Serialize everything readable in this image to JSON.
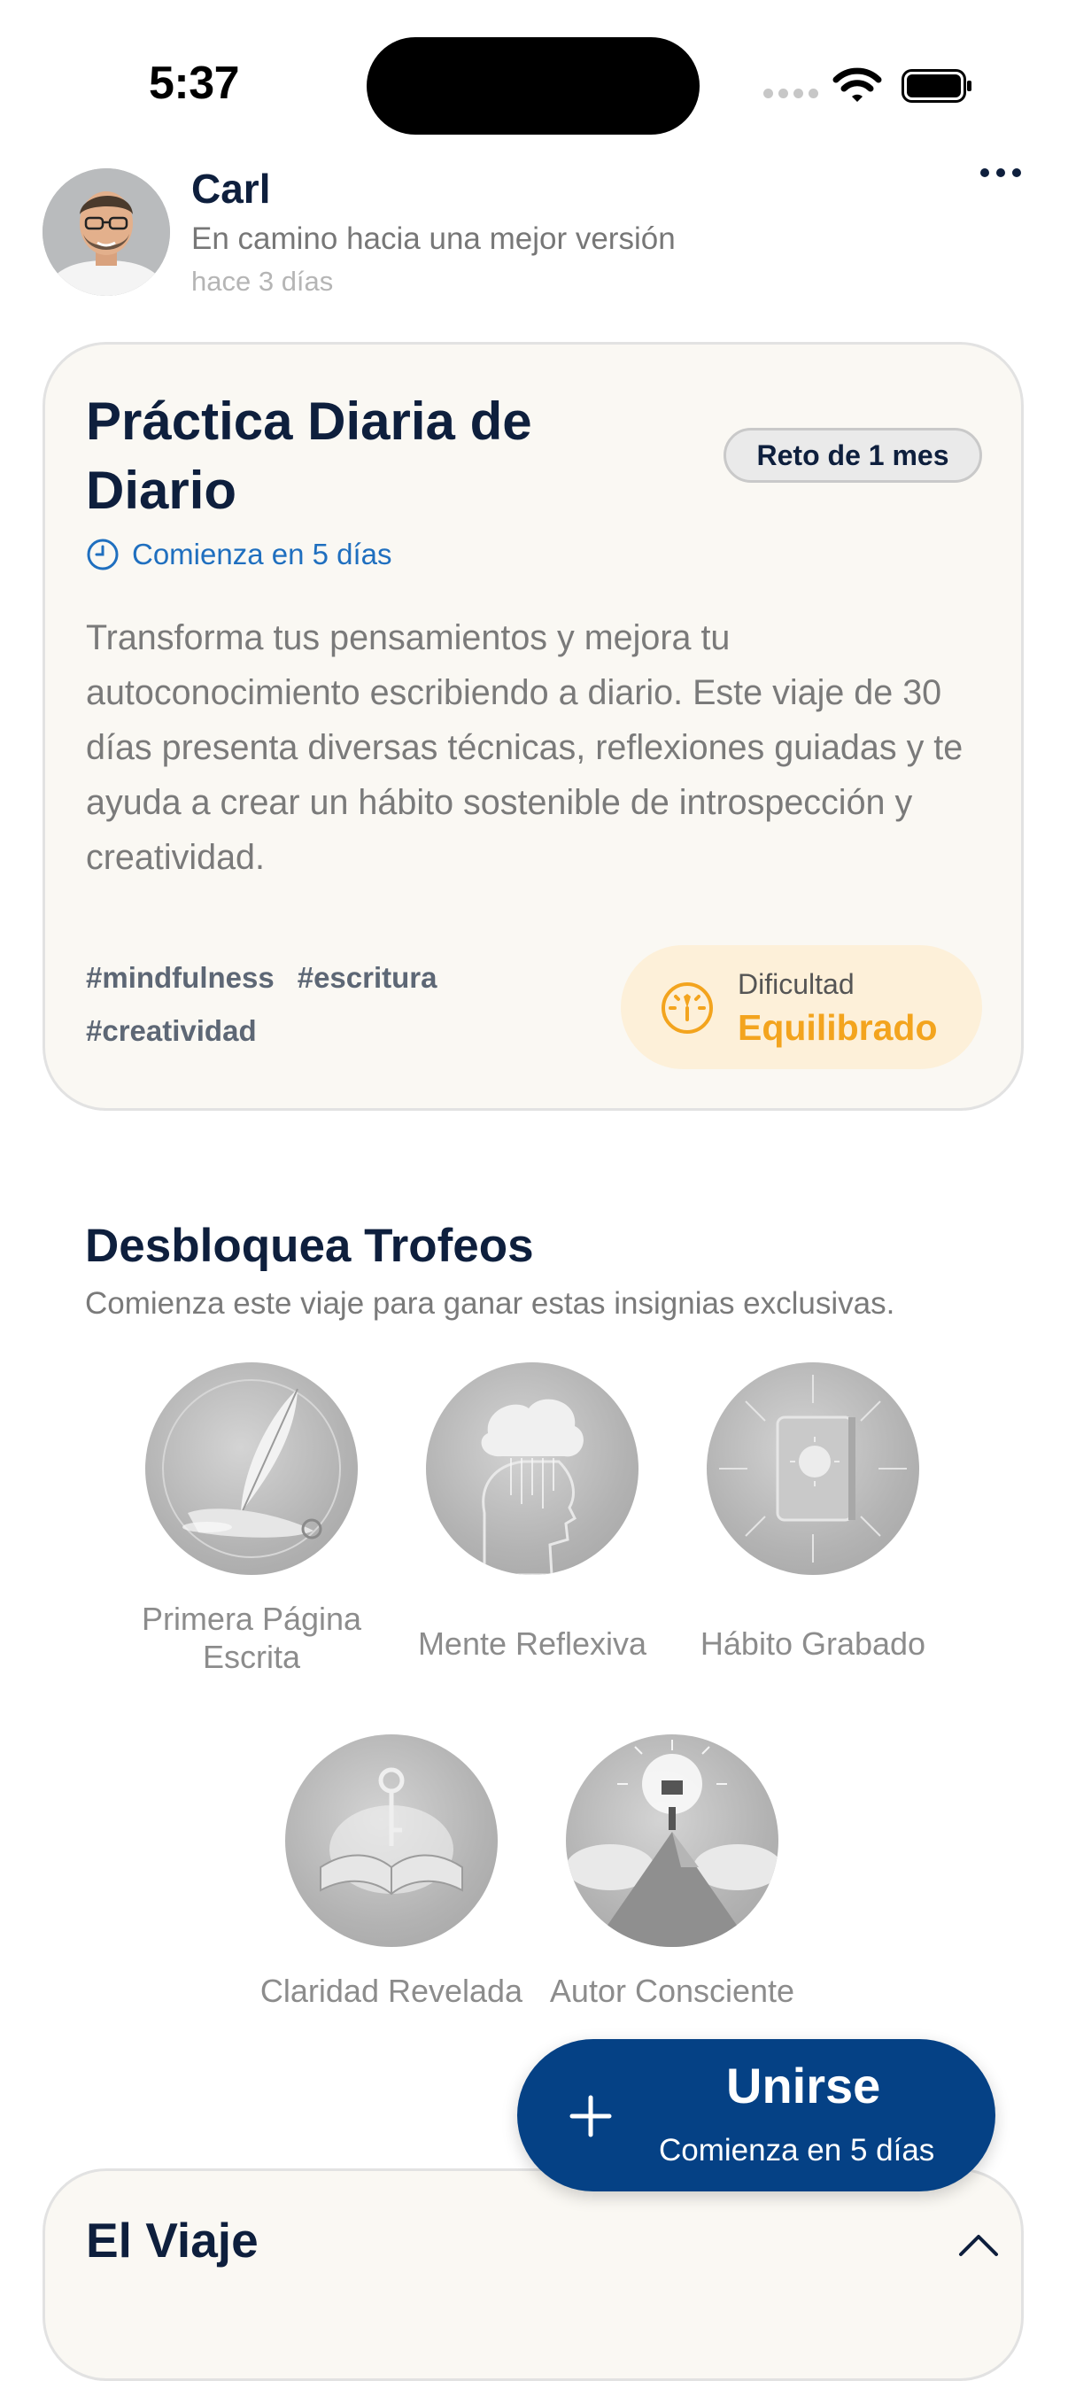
{
  "status_bar": {
    "time": "5:37"
  },
  "author": {
    "name": "Carl",
    "tagline": "En camino hacia una mejor versión",
    "posted": "hace 3 días"
  },
  "challenge": {
    "title": "Práctica Diaria de Diario",
    "badge": "Reto de 1 mes",
    "starts": "Comienza en 5 días",
    "description": "Transforma tus pensamientos y mejora tu autoconocimiento escribiendo a diario. Este viaje de 30 días presenta diversas técnicas, reflexiones guiadas y te ayuda a crear un hábito sostenible de introspección y creatividad.",
    "tags": [
      "#mindfulness",
      "#escritura",
      "#creatividad"
    ],
    "difficulty_label": "Dificultad",
    "difficulty_value": "Equilibrado"
  },
  "trophies": {
    "title": "Desbloquea Trofeos",
    "subtitle": "Comienza este viaje para ganar estas insignias exclusivas.",
    "items": [
      {
        "label": "Primera Página Escrita",
        "icon": "quill-scroll-icon"
      },
      {
        "label": "Mente Reflexiva",
        "icon": "thinking-head-icon"
      },
      {
        "label": "Hábito Grabado",
        "icon": "journal-sun-icon"
      },
      {
        "label": "Claridad Revelada",
        "icon": "book-key-icon"
      },
      {
        "label": "Autor Consciente",
        "icon": "summit-book-icon"
      }
    ]
  },
  "join_button": {
    "title": "Unirse",
    "subtitle": "Comienza en 5 días"
  },
  "journey": {
    "title": "El Viaje"
  },
  "colors": {
    "accent_blue": "#054185",
    "link_blue": "#1f6fbf",
    "difficulty_orange": "#f3a41e",
    "card_bg": "#faf8f3"
  }
}
